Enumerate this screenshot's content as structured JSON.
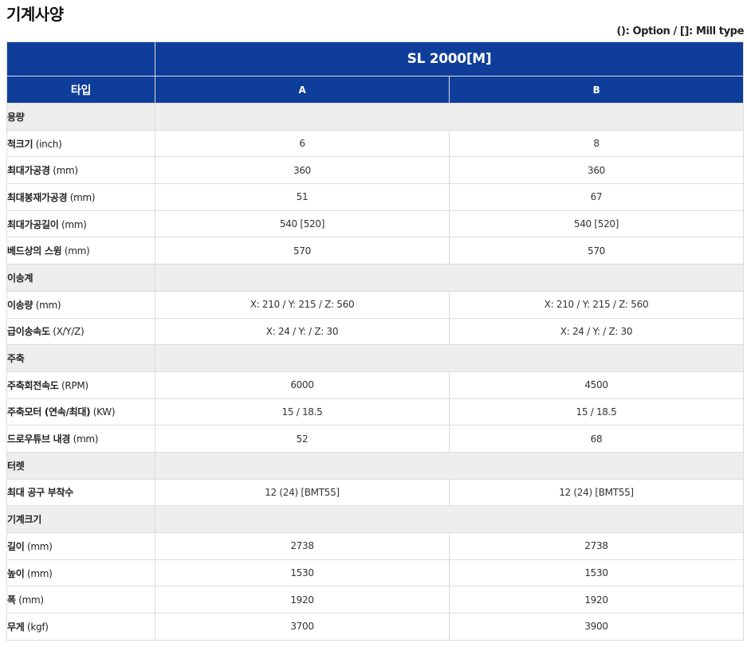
{
  "title": "기계사양",
  "legend_note": "(): Option / []: Mill type",
  "table": {
    "model": "SL 2000[M]",
    "type_label": "타입",
    "types": [
      "A",
      "B"
    ],
    "rows": [
      {
        "kind": "section",
        "label": "용량"
      },
      {
        "kind": "data",
        "label": "척크기",
        "unit": "(inch)",
        "values": [
          "6",
          "8"
        ]
      },
      {
        "kind": "data",
        "label": "최대가공경",
        "unit": "(mm)",
        "values": [
          "360",
          "360"
        ]
      },
      {
        "kind": "data",
        "label": "최대봉재가공경",
        "unit": "(mm)",
        "values": [
          "51",
          "67"
        ]
      },
      {
        "kind": "data",
        "label": "최대가공길이",
        "unit": "(mm)",
        "values": [
          "540 [520]",
          "540 [520]"
        ]
      },
      {
        "kind": "data",
        "label": "베드상의 스윙",
        "unit": "(mm)",
        "values": [
          "570",
          "570"
        ]
      },
      {
        "kind": "section",
        "label": "이송계"
      },
      {
        "kind": "data",
        "label": "이송량",
        "unit": "(mm)",
        "values": [
          "X: 210 / Y: 215 / Z: 560",
          "X: 210 / Y: 215 / Z: 560"
        ]
      },
      {
        "kind": "data",
        "label": "급이송속도",
        "unit": "(X/Y/Z)",
        "values": [
          "X: 24 / Y: / Z: 30",
          "X: 24 / Y: / Z: 30"
        ]
      },
      {
        "kind": "section",
        "label": "주축"
      },
      {
        "kind": "data",
        "label": "주축회전속도",
        "unit": "(RPM)",
        "values": [
          "6000",
          "4500"
        ]
      },
      {
        "kind": "data",
        "label": "주축모터 (연속/최대)",
        "unit": "(KW)",
        "values": [
          "15 / 18.5",
          "15 / 18.5"
        ]
      },
      {
        "kind": "data",
        "label": "드로우튜브 내경",
        "unit": "(mm)",
        "values": [
          "52",
          "68"
        ]
      },
      {
        "kind": "section",
        "label": "터렛"
      },
      {
        "kind": "data",
        "label": "최대 공구 부착수",
        "unit": "",
        "values": [
          "12 (24) [BMT55]",
          "12 (24) [BMT55]"
        ]
      },
      {
        "kind": "section",
        "label": "기계크기"
      },
      {
        "kind": "data",
        "label": "길이",
        "unit": "(mm)",
        "values": [
          "2738",
          "2738"
        ]
      },
      {
        "kind": "data",
        "label": "높이",
        "unit": "(mm)",
        "values": [
          "1530",
          "1530"
        ]
      },
      {
        "kind": "data",
        "label": "폭",
        "unit": "(mm)",
        "values": [
          "1920",
          "1920"
        ]
      },
      {
        "kind": "data",
        "label": "무게",
        "unit": "(kgf)",
        "values": [
          "3700",
          "3900"
        ]
      }
    ]
  }
}
